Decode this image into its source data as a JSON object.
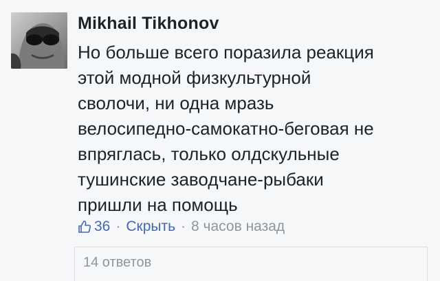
{
  "comment": {
    "author": "Mikhail Tikhonov",
    "text_lines": [
      "Но больше всего поразила реакция",
      "этой модной физкультурной",
      "сволочи, ни одна мразь",
      "велосипедно-самокатно-беговая не",
      "впряглась, только олдскульные",
      "тушинские заводчане-рыбаки",
      "пришли на помощь"
    ],
    "like_icon": "thumbs-up-icon",
    "like_count": "36",
    "separator": "·",
    "hide_label": "Скрыть",
    "timestamp": "8 часов назад",
    "replies_label": "14 ответов"
  },
  "colors": {
    "background": "#f6f7f9",
    "text": "#1d2129",
    "link": "#4267b2",
    "meta": "#90949c"
  }
}
